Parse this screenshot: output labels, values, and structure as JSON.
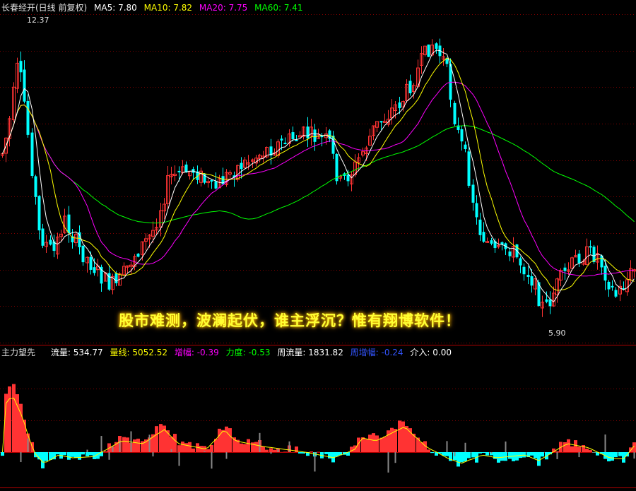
{
  "main": {
    "title": "长春经开(日线 前复权)",
    "ma": [
      {
        "label": "MA5: 7.80",
        "color": "#ffffff"
      },
      {
        "label": "MA10: 7.82",
        "color": "#ffff00"
      },
      {
        "label": "MA20: 7.75",
        "color": "#ff00ff"
      },
      {
        "label": "MA60: 7.41",
        "color": "#00ff00"
      }
    ],
    "high_label": "12.37",
    "low_label": "5.90",
    "slogan": "股市难测，波澜起伏，谁主浮沉？惟有翔博软件！"
  },
  "indicator": {
    "name": "主力望先",
    "fields": [
      {
        "label": "流量: 534.77",
        "color": "#ffffff"
      },
      {
        "label": "量线: 5052.52",
        "color": "#ffff00"
      },
      {
        "label": "增幅: -0.39",
        "color": "#ff00ff"
      },
      {
        "label": "力度: -0.53",
        "color": "#00ff00"
      },
      {
        "label": "周流量: 1831.82",
        "color": "#ffffff"
      },
      {
        "label": "周增幅: -0.24",
        "color": "#3355ff"
      },
      {
        "label": "介入: 0.00",
        "color": "#ffffff"
      }
    ]
  },
  "colors": {
    "up": "#ff3333",
    "down": "#00ffff",
    "grid": "#800000",
    "ma5": "#ffffff",
    "ma10": "#ffff00",
    "ma20": "#ff00ff",
    "ma60": "#00ff00"
  }
}
